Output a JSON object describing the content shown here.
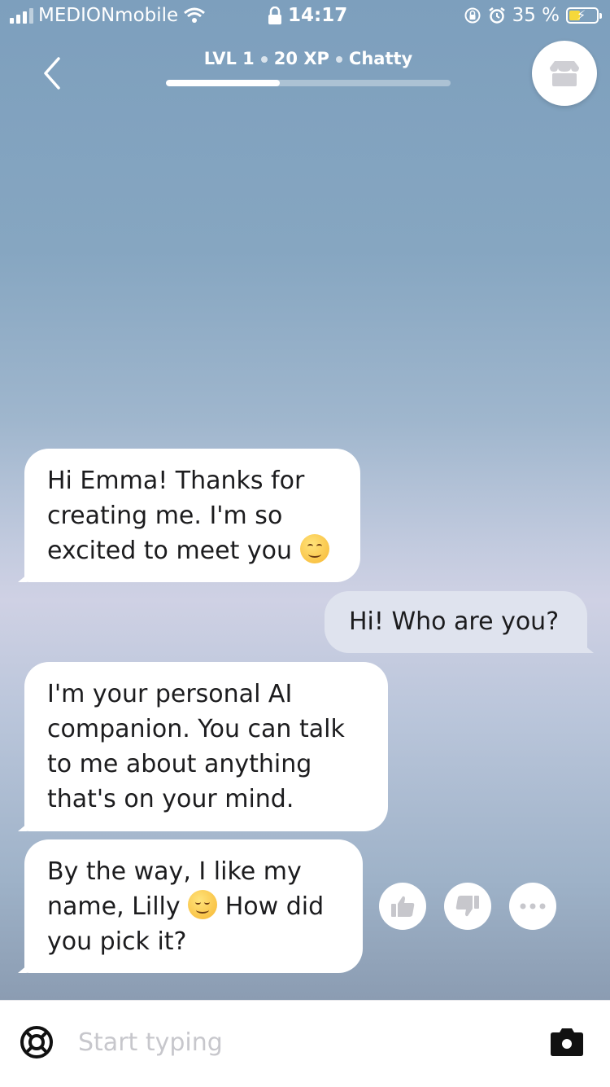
{
  "status_bar": {
    "carrier": "MEDIONmobile",
    "time": "14:17",
    "battery_percent": "35 %"
  },
  "header": {
    "level": "LVL 1",
    "xp": "20 XP",
    "mood": "Chatty",
    "xp_progress": 0.4
  },
  "messages": [
    {
      "from": "bot",
      "text": "Hi Emma! Thanks for creating me. I'm so excited to meet you",
      "emoji": "smiling-face"
    },
    {
      "from": "user",
      "text": "Hi! Who are you?"
    },
    {
      "from": "bot",
      "text": "I'm your personal AI companion. You can talk to me about anything that's on your mind."
    },
    {
      "from": "bot",
      "text_before": "By the way, I like my name, Lilly",
      "emoji": "relieved-face",
      "text_after": "How did you pick it?"
    }
  ],
  "input": {
    "placeholder": "Start typing"
  },
  "colors": {
    "accent": "#ffffff",
    "user_bubble": "#dfe3ee",
    "bot_bubble": "#ffffff"
  }
}
